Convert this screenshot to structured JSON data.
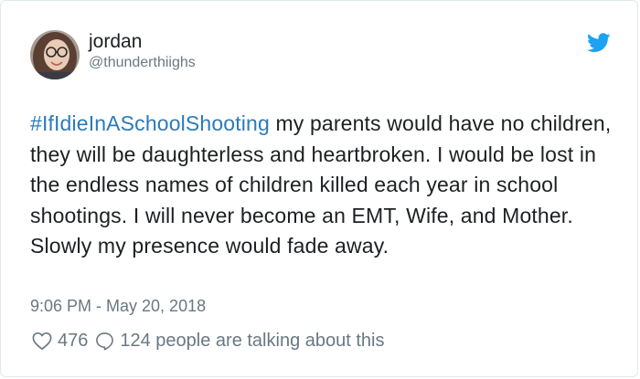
{
  "user": {
    "name": "jordan",
    "handle": "@thunderthiighs"
  },
  "tweet": {
    "hashtag": "#IfIdieInASchoolShooting",
    "body": " my parents would have no children, they will be daughterless and heartbroken. I would be lost in the endless names of children killed each year in school shootings. I will never become an EMT, Wife, and Mother. Slowly my presence would fade away."
  },
  "meta": {
    "timestamp": "9:06 PM - May 20, 2018"
  },
  "actions": {
    "likes": "476",
    "talking": "124 people are talking about this"
  },
  "icons": {
    "brand": "twitter-bird-icon",
    "like": "heart-icon",
    "reply": "speech-bubble-icon"
  },
  "colors": {
    "link": "#2b7bb9",
    "brand": "#1da1f2",
    "text": "#1c2022",
    "muted": "#697882"
  }
}
